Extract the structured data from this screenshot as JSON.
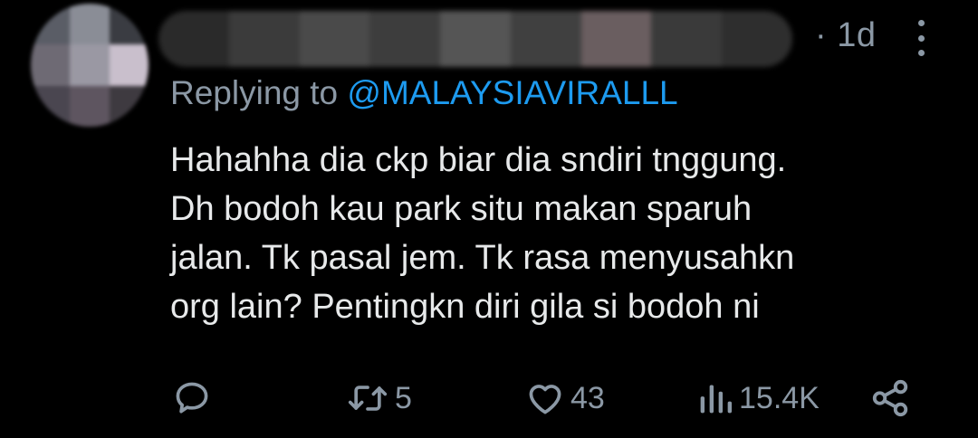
{
  "tweet": {
    "time": "· 1d",
    "reply_prefix": "Replying to",
    "reply_handle": "@MALAYSIAVIRALLL",
    "text_lines": [
      "Hahahha dia ckp biar dia sndiri tnggung.",
      "Dh bodoh kau park situ makan sparuh",
      "jalan. Tk pasal jem. Tk rasa menyusahkn",
      "org lain? Pentingkn diri gila si bodoh ni"
    ]
  },
  "actions": {
    "reply": {
      "icon": "reply-icon",
      "count": ""
    },
    "retweet": {
      "icon": "retweet-icon",
      "count": "5"
    },
    "like": {
      "icon": "heart-icon",
      "count": "43"
    },
    "views": {
      "icon": "views-icon",
      "count": "15.4K"
    },
    "share": {
      "icon": "share-icon"
    }
  },
  "colors": {
    "background": "#000000",
    "text": "#e7e9ea",
    "muted": "#8b98a5",
    "link": "#1d9bf0"
  }
}
